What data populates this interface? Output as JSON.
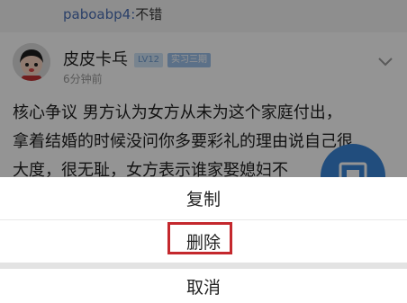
{
  "reply": {
    "user": "paboabp4:",
    "text": "不错"
  },
  "post": {
    "user_name": "皮皮卡乓",
    "level_badge": "LV12",
    "tag_badge": "实习三期",
    "time": "6分钟前",
    "content_lines": [
      "核心争议 男方认为女方从未为这个家庭付出，",
      "拿着结婚的时候没问你多要彩礼的理由说自己很",
      "大度，很无耻，女方表示谁家娶媳妇不"
    ]
  },
  "action_sheet": {
    "copy_label": "复制",
    "delete_label": "删除",
    "cancel_label": "取消"
  },
  "colors": {
    "accent_blue": "#3a86d8",
    "highlight_red": "#c4282d",
    "username_blue": "#4a6fb5"
  }
}
